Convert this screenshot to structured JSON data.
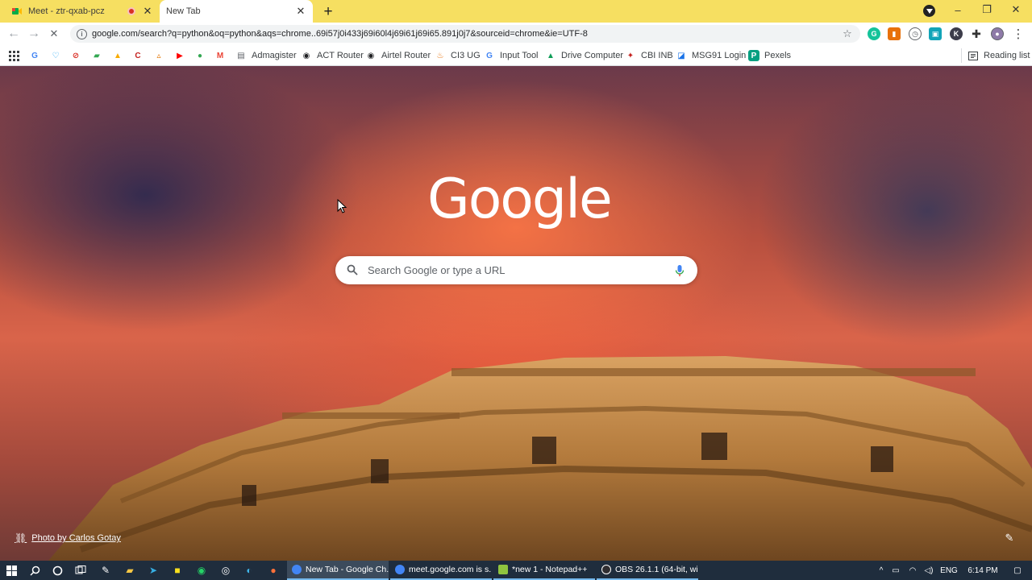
{
  "window": {
    "tabs": [
      {
        "title": "Meet - ztr-qxab-pcz",
        "active": false,
        "recording": true,
        "favicon": "google-meet-icon"
      },
      {
        "title": "New Tab",
        "active": true,
        "favicon": "none"
      }
    ],
    "new_tab_symbol": "+",
    "controls": {
      "minimize": "–",
      "restore": "❐",
      "close": "✕"
    }
  },
  "toolbar": {
    "back_symbol": "←",
    "forward_symbol": "→",
    "reload_symbol": "✕",
    "url": "google.com/search?q=python&oq=python&aqs=chrome..69i57j0i433j69i60l4j69i61j69i65.891j0j7&sourceid=chrome&ie=UTF-8",
    "star_symbol": "☆",
    "menu_symbol": "⋮",
    "extensions": [
      "grammarly-icon",
      "extension-red-icon",
      "extension-clock-icon",
      "extension-teal-icon",
      "profile-dark-icon",
      "puzzle-icon",
      "avatar-icon"
    ]
  },
  "bookmarks": {
    "icon_only": [
      {
        "icon": "apps-grid-icon",
        "glyph": "⋮⋮",
        "color": "#3c4043"
      },
      {
        "icon": "google-g-icon",
        "glyph": "G",
        "color": "#4285f4"
      },
      {
        "icon": "heart-blue-icon",
        "glyph": "♡",
        "color": "#1da1f2"
      },
      {
        "icon": "block-red-icon",
        "glyph": "⊘",
        "color": "#d93025"
      },
      {
        "icon": "green-square-icon",
        "glyph": "▰",
        "color": "#34a853"
      },
      {
        "icon": "yellow-photo-icon",
        "glyph": "▲",
        "color": "#f9ab00"
      },
      {
        "icon": "c-red-icon",
        "glyph": "C",
        "color": "#c5221f"
      },
      {
        "icon": "triangle-icon",
        "glyph": "▵",
        "color": "#e37400"
      },
      {
        "icon": "youtube-icon",
        "glyph": "▶",
        "color": "#ff0000"
      },
      {
        "icon": "maps-pin-icon",
        "glyph": "●",
        "color": "#34a853"
      },
      {
        "icon": "gmail-icon",
        "glyph": "M",
        "color": "#ea4335"
      }
    ],
    "items": [
      {
        "label": "Admagister",
        "icon": "document-icon",
        "glyph": "▤",
        "color": "#5f6368"
      },
      {
        "label": "ACT Router",
        "icon": "globe-icon",
        "glyph": "◉",
        "color": "#202124"
      },
      {
        "label": "Airtel Router",
        "icon": "globe-icon",
        "glyph": "◉",
        "color": "#202124"
      },
      {
        "label": "CI3 UG",
        "icon": "flame-icon",
        "glyph": "♨",
        "color": "#e8710a"
      },
      {
        "label": "Input Tool",
        "icon": "google-g-icon",
        "glyph": "G",
        "color": "#4285f4"
      },
      {
        "label": "Drive Computer",
        "icon": "drive-icon",
        "glyph": "▲",
        "color": "#0f9d58"
      },
      {
        "label": "CBI INB",
        "icon": "cbi-icon",
        "glyph": "✦",
        "color": "#c5221f"
      },
      {
        "label": "MSG91 Login",
        "icon": "msg91-icon",
        "glyph": "◪",
        "color": "#1a73e8"
      },
      {
        "label": "Pexels",
        "icon": "pexels-icon",
        "glyph": "P",
        "color": "#05a081"
      }
    ],
    "reading_list": "Reading list"
  },
  "ntp": {
    "logo_text": "Google",
    "search_placeholder": "Search Google or type a URL",
    "photo_credit": "Photo by Carlos Gotay",
    "customize_symbol": "✎"
  },
  "taskbar": {
    "apps": [
      {
        "label": "New Tab - Google Ch...",
        "active": true,
        "icon_color": "#4285f4"
      },
      {
        "label": "meet.google.com is s...",
        "active": false,
        "icon_color": "#4285f4"
      },
      {
        "label": "*new 1 - Notepad++",
        "active": false,
        "icon_color": "#90c53f"
      },
      {
        "label": "OBS 26.1.1 (64-bit, wi...",
        "active": false,
        "icon_color": "#302e31"
      }
    ],
    "language": "ENG",
    "time": "6:14 PM"
  }
}
